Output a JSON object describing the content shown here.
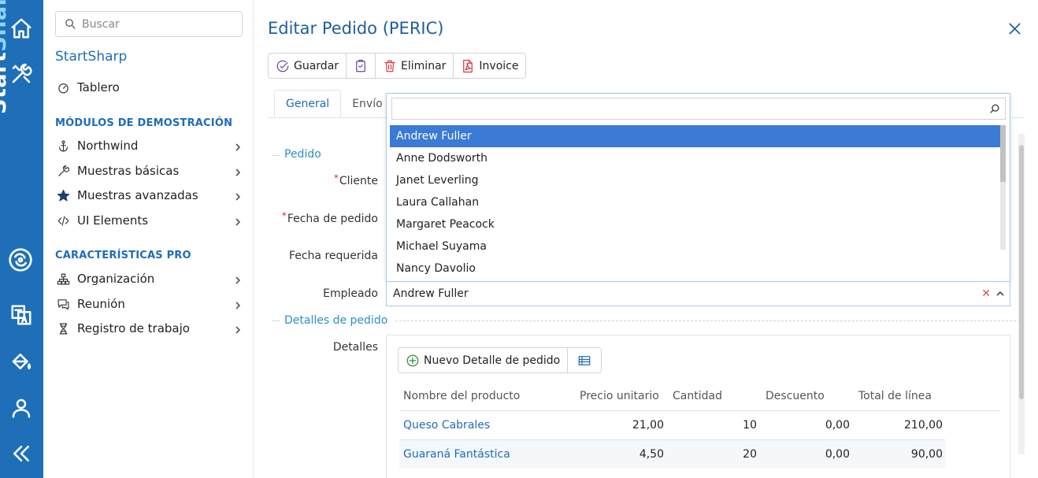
{
  "rail": {
    "brand_text_a": "Start",
    "brand_text_b": "Sharp"
  },
  "sidebar": {
    "search_placeholder": "Buscar",
    "app_title": "StartSharp",
    "dashboard": "Tablero",
    "section_demo": "MÓDULOS DE DEMOSTRACIÓN",
    "demo_items": [
      {
        "label": "Northwind",
        "icon": "anchor-icon"
      },
      {
        "label": "Muestras básicas",
        "icon": "tools-icon"
      },
      {
        "label": "Muestras avanzadas",
        "icon": "star-icon"
      },
      {
        "label": "UI Elements",
        "icon": "code-icon"
      }
    ],
    "section_pro": "CARACTERÍSTICAS PRO",
    "pro_items": [
      {
        "label": "Organización",
        "icon": "org-chart-icon"
      },
      {
        "label": "Reunión",
        "icon": "chat-icon"
      },
      {
        "label": "Registro de trabajo",
        "icon": "hourglass-icon"
      }
    ]
  },
  "dialog": {
    "title": "Editar Pedido (PERIC)",
    "toolbar": {
      "save": "Guardar",
      "delete": "Eliminar",
      "invoice": "Invoice"
    },
    "tabs": [
      "General",
      "Envío"
    ],
    "fieldset_order": "Pedido",
    "labels": {
      "customer": "Cliente",
      "order_date": "Fecha de pedido",
      "required_date": "Fecha requerida",
      "employee": "Empleado"
    },
    "employee_value": "Andrew Fuller",
    "employee_search_value": "",
    "employee_options": [
      "Andrew Fuller",
      "Anne Dodsworth",
      "Janet Leverling",
      "Laura Callahan",
      "Margaret Peacock",
      "Michael Suyama",
      "Nancy Davolio"
    ],
    "fieldset_details": "Detalles de pedido",
    "details_label": "Detalles",
    "details_grid": {
      "new_button": "Nuevo Detalle de pedido",
      "columns": [
        "Nombre del producto",
        "Precio unitario",
        "Cantidad",
        "Descuento",
        "Total de línea"
      ],
      "rows": [
        [
          "Queso Cabrales",
          "21,00",
          "10",
          "0,00",
          "210,00"
        ],
        [
          "Guaraná Fantástica",
          "4,50",
          "20",
          "0,00",
          "90,00"
        ]
      ]
    }
  }
}
